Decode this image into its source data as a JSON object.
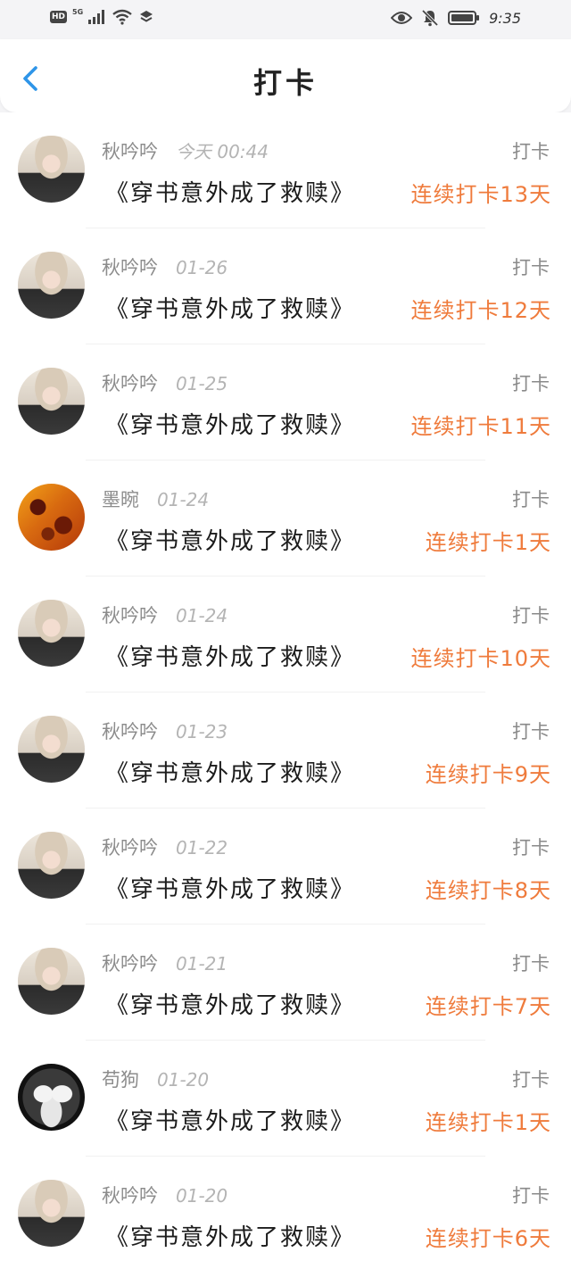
{
  "status_bar": {
    "hd_label": "HD",
    "network_label": "5G",
    "time": "9:35"
  },
  "header": {
    "title": "打卡"
  },
  "colors": {
    "accent_back": "#2e95e8",
    "streak": "#ef7b3c"
  },
  "rows": [
    {
      "avatar": "avatar-girl",
      "name": "秋吟吟",
      "date": "今天 00:44",
      "label": "打卡",
      "book": "《穿书意外成了救赎》",
      "streak": "连续打卡13天"
    },
    {
      "avatar": "avatar-girl",
      "name": "秋吟吟",
      "date": "01-26",
      "label": "打卡",
      "book": "《穿书意外成了救赎》",
      "streak": "连续打卡12天"
    },
    {
      "avatar": "avatar-girl",
      "name": "秋吟吟",
      "date": "01-25",
      "label": "打卡",
      "book": "《穿书意外成了救赎》",
      "streak": "连续打卡11天"
    },
    {
      "avatar": "avatar-orange",
      "name": "墨晼",
      "date": "01-24",
      "label": "打卡",
      "book": "《穿书意外成了救赎》",
      "streak": "连续打卡1天"
    },
    {
      "avatar": "avatar-girl",
      "name": "秋吟吟",
      "date": "01-24",
      "label": "打卡",
      "book": "《穿书意外成了救赎》",
      "streak": "连续打卡10天"
    },
    {
      "avatar": "avatar-girl",
      "name": "秋吟吟",
      "date": "01-23",
      "label": "打卡",
      "book": "《穿书意外成了救赎》",
      "streak": "连续打卡9天"
    },
    {
      "avatar": "avatar-girl",
      "name": "秋吟吟",
      "date": "01-22",
      "label": "打卡",
      "book": "《穿书意外成了救赎》",
      "streak": "连续打卡8天"
    },
    {
      "avatar": "avatar-girl",
      "name": "秋吟吟",
      "date": "01-21",
      "label": "打卡",
      "book": "《穿书意外成了救赎》",
      "streak": "连续打卡7天"
    },
    {
      "avatar": "avatar-meme",
      "name": "苟狗",
      "date": "01-20",
      "label": "打卡",
      "book": "《穿书意外成了救赎》",
      "streak": "连续打卡1天"
    },
    {
      "avatar": "avatar-girl",
      "name": "秋吟吟",
      "date": "01-20",
      "label": "打卡",
      "book": "《穿书意外成了救赎》",
      "streak": "连续打卡6天"
    }
  ]
}
